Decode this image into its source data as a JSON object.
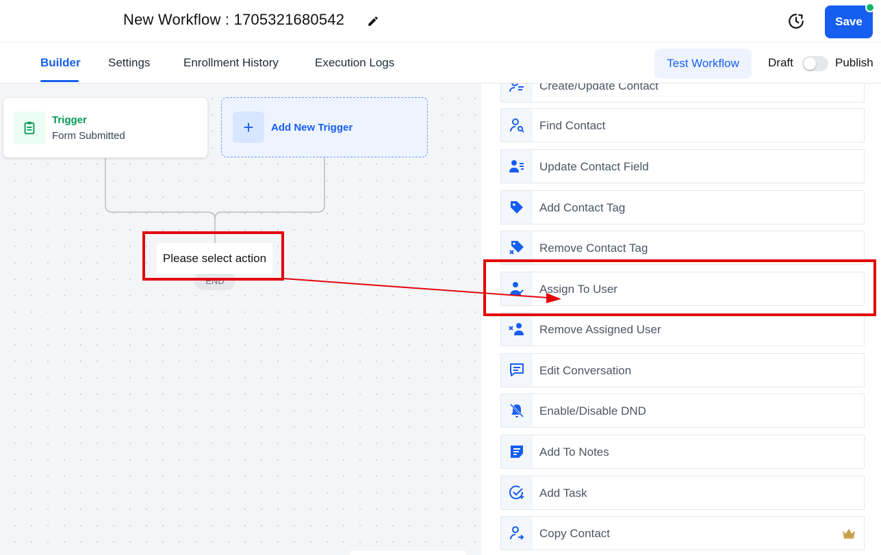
{
  "header": {
    "workflow_title": "New Workflow : 1705321680542",
    "save_label": "Save"
  },
  "tabs": [
    {
      "label": "Builder",
      "active": true
    },
    {
      "label": "Settings",
      "active": false
    },
    {
      "label": "Enrollment History",
      "active": false
    },
    {
      "label": "Execution Logs",
      "active": false
    }
  ],
  "toolbar": {
    "test_workflow_label": "Test Workflow",
    "draft_label": "Draft",
    "publish_label": "Publish",
    "publish_toggle_on": false
  },
  "canvas": {
    "trigger": {
      "title": "Trigger",
      "subtitle": "Form Submitted",
      "icon": "clipboard-icon"
    },
    "add_trigger_label": "Add New Trigger",
    "select_action_label": "Please select action",
    "end_label": "END"
  },
  "actions": [
    {
      "label": "Create/Update Contact",
      "icon": "contact-edit-icon"
    },
    {
      "label": "Find Contact",
      "icon": "find-contact-icon"
    },
    {
      "label": "Update Contact Field",
      "icon": "update-contact-field-icon"
    },
    {
      "label": "Add Contact Tag",
      "icon": "tag-icon"
    },
    {
      "label": "Remove Contact Tag",
      "icon": "remove-tag-icon"
    },
    {
      "label": "Assign To User",
      "icon": "assign-user-icon"
    },
    {
      "label": "Remove Assigned User",
      "icon": "remove-user-icon"
    },
    {
      "label": "Edit Conversation",
      "icon": "conversation-icon"
    },
    {
      "label": "Enable/Disable DND",
      "icon": "dnd-bell-icon"
    },
    {
      "label": "Add To Notes",
      "icon": "notes-icon"
    },
    {
      "label": "Add Task",
      "icon": "add-task-icon"
    },
    {
      "label": "Copy Contact",
      "icon": "copy-contact-icon",
      "premium": true
    }
  ],
  "colors": {
    "primary": "#155eef",
    "trigger_green": "#039855",
    "annotation_red": "#e3050b",
    "status_green": "#12b76a"
  }
}
